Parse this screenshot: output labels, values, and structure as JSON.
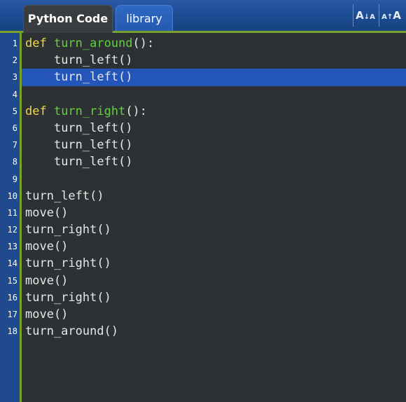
{
  "tabs": [
    {
      "label": "Python Code",
      "active": true
    },
    {
      "label": "library",
      "active": false
    }
  ],
  "font_controls": {
    "decrease": {
      "big": "A",
      "arrow": "↓",
      "small": "A"
    },
    "increase": {
      "small": "A",
      "arrow": "↑",
      "big": "A"
    }
  },
  "colors": {
    "keyword": "#f0d64a",
    "function_name": "#5fd23a",
    "text": "#e6e6e6",
    "highlight": "#2455b8",
    "accent": "#7aa128",
    "header": "#1b4b91"
  },
  "highlighted_line": 3,
  "code_lines": [
    {
      "n": "1",
      "indent": "",
      "kw": "def ",
      "fn": "turn_around",
      "text": "():"
    },
    {
      "n": "2",
      "indent": "    ",
      "kw": "",
      "fn": "",
      "text": "turn_left()"
    },
    {
      "n": "3",
      "indent": "    ",
      "kw": "",
      "fn": "",
      "text": "turn_left()"
    },
    {
      "n": "4",
      "indent": "",
      "kw": "",
      "fn": "",
      "text": ""
    },
    {
      "n": "5",
      "indent": "",
      "kw": "def ",
      "fn": "turn_right",
      "text": "():"
    },
    {
      "n": "6",
      "indent": "    ",
      "kw": "",
      "fn": "",
      "text": "turn_left()"
    },
    {
      "n": "7",
      "indent": "    ",
      "kw": "",
      "fn": "",
      "text": "turn_left()"
    },
    {
      "n": "8",
      "indent": "    ",
      "kw": "",
      "fn": "",
      "text": "turn_left()"
    },
    {
      "n": "9",
      "indent": "",
      "kw": "",
      "fn": "",
      "text": ""
    },
    {
      "n": "10",
      "indent": "",
      "kw": "",
      "fn": "",
      "text": "turn_left()"
    },
    {
      "n": "11",
      "indent": "",
      "kw": "",
      "fn": "",
      "text": "move()"
    },
    {
      "n": "12",
      "indent": "",
      "kw": "",
      "fn": "",
      "text": "turn_right()"
    },
    {
      "n": "13",
      "indent": "",
      "kw": "",
      "fn": "",
      "text": "move()"
    },
    {
      "n": "14",
      "indent": "",
      "kw": "",
      "fn": "",
      "text": "turn_right()"
    },
    {
      "n": "15",
      "indent": "",
      "kw": "",
      "fn": "",
      "text": "move()"
    },
    {
      "n": "16",
      "indent": "",
      "kw": "",
      "fn": "",
      "text": "turn_right()"
    },
    {
      "n": "17",
      "indent": "",
      "kw": "",
      "fn": "",
      "text": "move()"
    },
    {
      "n": "18",
      "indent": "",
      "kw": "",
      "fn": "",
      "text": "turn_around()"
    }
  ]
}
